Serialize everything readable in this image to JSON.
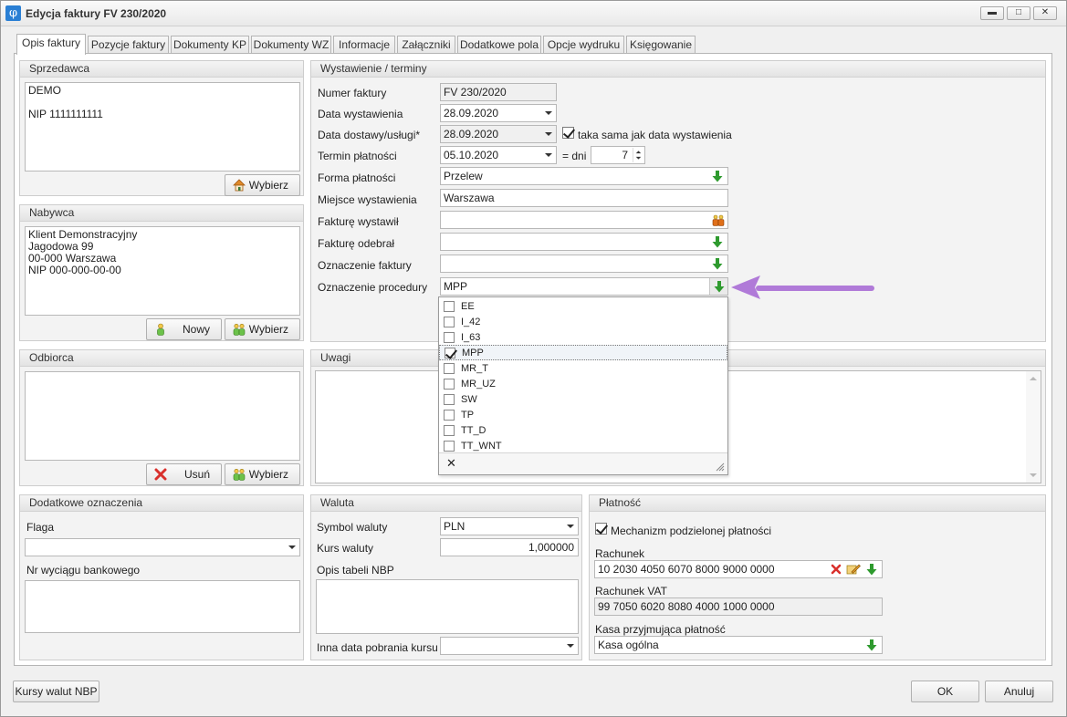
{
  "window": {
    "title": "Edycja faktury FV 230/2020",
    "minimize_glyph": "▬",
    "maximize_glyph": "□",
    "close_glyph": "✕"
  },
  "tabs": [
    "Opis faktury",
    "Pozycje faktury",
    "Dokumenty KP",
    "Dokumenty WZ",
    "Informacje",
    "Załączniki",
    "Dodatkowe pola",
    "Opcje wydruku",
    "Księgowanie"
  ],
  "sprzedawca": {
    "header": "Sprzedawca",
    "lines": [
      "DEMO",
      "",
      "NIP 1111111111"
    ],
    "select_button": "Wybierz"
  },
  "nabywca": {
    "header": "Nabywca",
    "lines": [
      "Klient Demonstracyjny",
      "Jagodowa 99",
      "00-000 Warszawa",
      "NIP 000-000-00-00"
    ],
    "new_button": "Nowy",
    "select_button": "Wybierz"
  },
  "odbiorca": {
    "header": "Odbiorca",
    "remove_button": "Usuń",
    "select_button": "Wybierz"
  },
  "dodatkowe": {
    "header": "Dodatkowe oznaczenia",
    "flag_label": "Flaga",
    "flag_value": "",
    "bank_statement_label": "Nr wyciągu bankowego"
  },
  "wystawienie": {
    "header": "Wystawienie / terminy",
    "invoice_number_label": "Numer faktury",
    "invoice_number": "FV 230/2020",
    "issue_date_label": "Data wystawienia",
    "issue_date": "28.09.2020",
    "delivery_date_label": "Data dostawy/usługi*",
    "delivery_date": "28.09.2020",
    "same_as_issue_label": "taka sama jak data wystawienia",
    "same_as_issue_checked": true,
    "due_date_label": "Termin płatności",
    "due_date": "05.10.2020",
    "days_label": "= dni",
    "days_value": "7",
    "payment_form_label": "Forma płatności",
    "payment_form": "Przelew",
    "place_label": "Miejsce wystawienia",
    "place": "Warszawa",
    "issued_by_label": "Fakturę wystawił",
    "issued_by": "",
    "received_by_label": "Fakturę odebrał",
    "received_by": "",
    "invoice_marking_label": "Oznaczenie faktury",
    "invoice_marking": "",
    "procedure_label": "Oznaczenie procedury",
    "procedure": "MPP"
  },
  "procedure_options": [
    {
      "label": "EE",
      "checked": false
    },
    {
      "label": "I_42",
      "checked": false
    },
    {
      "label": "I_63",
      "checked": false
    },
    {
      "label": "MPP",
      "checked": true
    },
    {
      "label": "MR_T",
      "checked": false
    },
    {
      "label": "MR_UZ",
      "checked": false
    },
    {
      "label": "SW",
      "checked": false
    },
    {
      "label": "TP",
      "checked": false
    },
    {
      "label": "TT_D",
      "checked": false
    },
    {
      "label": "TT_WNT",
      "checked": false
    }
  ],
  "popup_close_glyph": "✕",
  "uwagi": {
    "header": "Uwagi"
  },
  "waluta": {
    "header": "Waluta",
    "symbol_label": "Symbol waluty",
    "symbol": "PLN",
    "rate_label": "Kurs waluty",
    "rate": "1,000000",
    "nbp_table_label": "Opis tabeli NBP",
    "other_date_label": "Inna data pobrania kursu",
    "other_date": ""
  },
  "platnosc": {
    "header": "Płatność",
    "split_payment_label": "Mechanizm podzielonej płatności",
    "split_payment_checked": true,
    "account_label": "Rachunek",
    "account": "10 2030 4050 6070 8000 9000 0000",
    "vat_account_label": "Rachunek VAT",
    "vat_account": "99 7050 6020 8080 4000 1000 0000",
    "cash_label": "Kasa przyjmująca płatność",
    "cash": "Kasa ogólna"
  },
  "footer": {
    "nbp_rates_button": "Kursy walut NBP",
    "ok_button": "OK",
    "cancel_button": "Anuluj"
  },
  "colors": {
    "accent_arrow": "#b07ad8",
    "green_arrow": "#2e9a2e",
    "red_x": "#d9302c"
  }
}
